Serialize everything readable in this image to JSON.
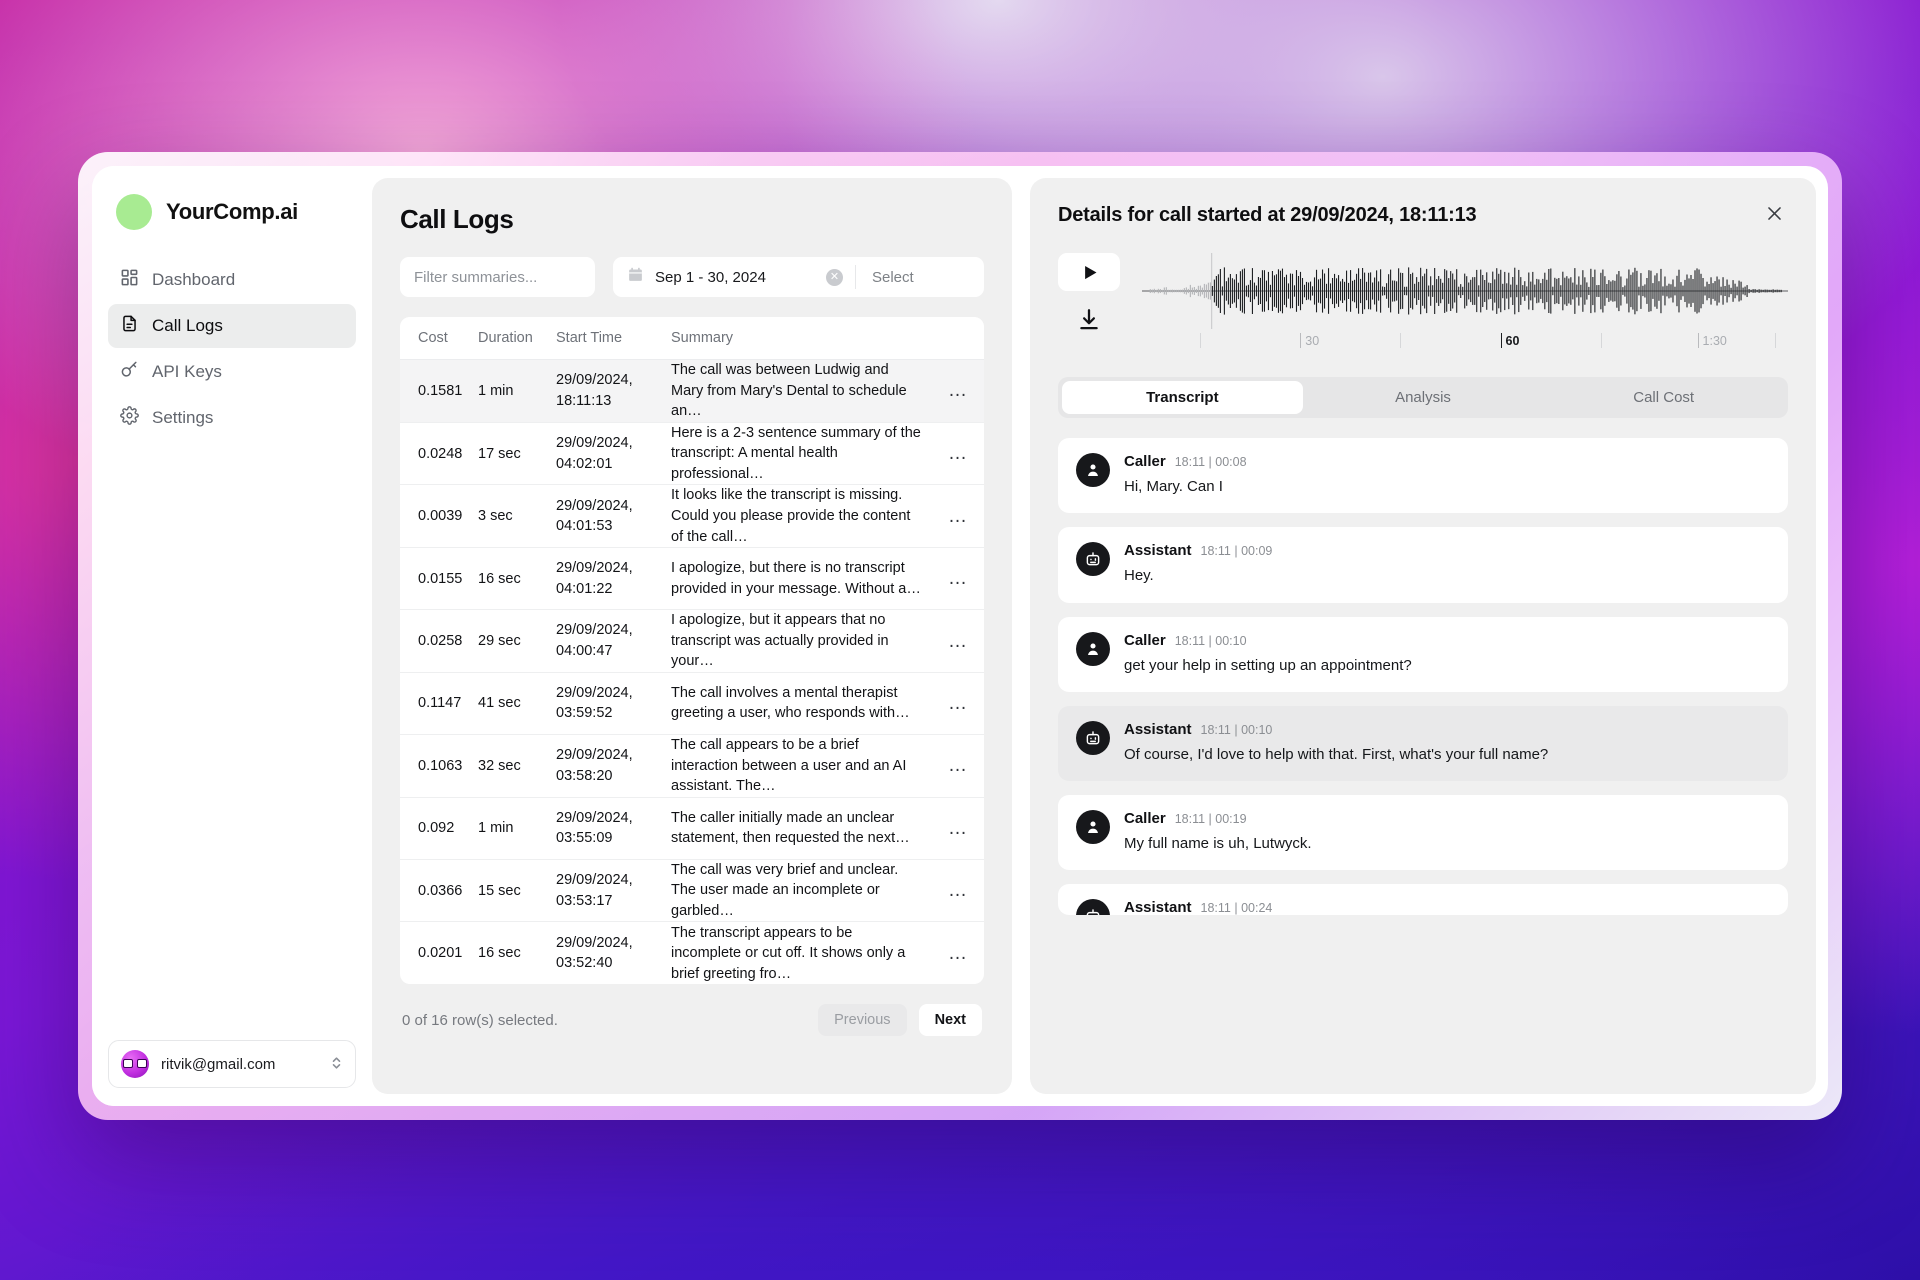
{
  "sidebar": {
    "brand": "YourComp.ai",
    "items": [
      {
        "label": "Dashboard",
        "icon": "dashboard-icon"
      },
      {
        "label": "Call Logs",
        "icon": "document-icon"
      },
      {
        "label": "API Keys",
        "icon": "key-icon"
      },
      {
        "label": "Settings",
        "icon": "gear-icon"
      }
    ],
    "account": {
      "email": "ritvik@gmail.com",
      "icon": "chevron-updown-icon"
    }
  },
  "logs": {
    "title": "Call Logs",
    "filter_placeholder": "Filter summaries...",
    "date_range": "Sep 1 - 30, 2024",
    "date_clear_icon": "clear-circle-icon",
    "select_label": "Select",
    "columns": [
      "Cost",
      "Duration",
      "Start Time",
      "Summary"
    ],
    "rows": [
      {
        "cost": "0.1581",
        "duration": "1 min",
        "start_date": "29/09/2024,",
        "start_time": "18:11:13",
        "summary": "The call was between Ludwig and Mary from Mary's Dental to schedule an…"
      },
      {
        "cost": "0.0248",
        "duration": "17 sec",
        "start_date": "29/09/2024,",
        "start_time": "04:02:01",
        "summary": "Here is a 2-3 sentence summary of the transcript: A mental health professional…"
      },
      {
        "cost": "0.0039",
        "duration": "3 sec",
        "start_date": "29/09/2024,",
        "start_time": "04:01:53",
        "summary": "It looks like the transcript is missing. Could you please provide the content of the call…"
      },
      {
        "cost": "0.0155",
        "duration": "16 sec",
        "start_date": "29/09/2024,",
        "start_time": "04:01:22",
        "summary": "I apologize, but there is no transcript provided in your message. Without a…"
      },
      {
        "cost": "0.0258",
        "duration": "29 sec",
        "start_date": "29/09/2024,",
        "start_time": "04:00:47",
        "summary": "I apologize, but it appears that no transcript was actually provided in your…"
      },
      {
        "cost": "0.1147",
        "duration": "41 sec",
        "start_date": "29/09/2024,",
        "start_time": "03:59:52",
        "summary": "The call involves a mental therapist greeting a user, who responds with…"
      },
      {
        "cost": "0.1063",
        "duration": "32 sec",
        "start_date": "29/09/2024,",
        "start_time": "03:58:20",
        "summary": "The call appears to be a brief interaction between a user and an AI assistant. The…"
      },
      {
        "cost": "0.092",
        "duration": "1 min",
        "start_date": "29/09/2024,",
        "start_time": "03:55:09",
        "summary": "The caller initially made an unclear statement, then requested the next…"
      },
      {
        "cost": "0.0366",
        "duration": "15 sec",
        "start_date": "29/09/2024,",
        "start_time": "03:53:17",
        "summary": "The call was very brief and unclear. The user made an incomplete or garbled…"
      },
      {
        "cost": "0.0201",
        "duration": "16 sec",
        "start_date": "29/09/2024,",
        "start_time": "03:52:40",
        "summary": "The transcript appears to be incomplete or cut off. It shows only a brief greeting fro…"
      }
    ],
    "row_menu_glyph": "…",
    "selection_status": "0 of 16 row(s) selected.",
    "previous_label": "Previous",
    "next_label": "Next"
  },
  "details": {
    "title": "Details for call started at 29/09/2024, 18:11:13",
    "close_icon": "close-icon",
    "player": {
      "play_icon": "play-icon",
      "download_icon": "download-icon"
    },
    "ruler": {
      "labels": [
        "30",
        "60",
        "1:30"
      ],
      "current": "60"
    },
    "tabs": [
      {
        "label": "Transcript",
        "active": true
      },
      {
        "label": "Analysis",
        "active": false
      },
      {
        "label": "Call Cost",
        "active": false
      }
    ],
    "messages": [
      {
        "role": "Caller",
        "time": "18:11 | 00:08",
        "text": "Hi, Mary. Can I",
        "shaded": false
      },
      {
        "role": "Assistant",
        "time": "18:11 | 00:09",
        "text": "Hey.",
        "shaded": false
      },
      {
        "role": "Caller",
        "time": "18:11 | 00:10",
        "text": "get your help in setting up an appointment?",
        "shaded": false
      },
      {
        "role": "Assistant",
        "time": "18:11 | 00:10",
        "text": "Of course, I'd love to help with that. First, what's your full name?",
        "shaded": true
      },
      {
        "role": "Caller",
        "time": "18:11 | 00:19",
        "text": "My full name is uh, Lutwyck.",
        "shaded": false
      }
    ],
    "partial_message": {
      "role": "Assistant",
      "time": "18:11 | 00:24"
    }
  },
  "colors": {
    "brand_dot": "#a8eb92",
    "panel_bg": "#f0f0f0",
    "active_nav": "#eceded",
    "text_primary": "#0e0e10",
    "text_muted": "#6e7279"
  }
}
